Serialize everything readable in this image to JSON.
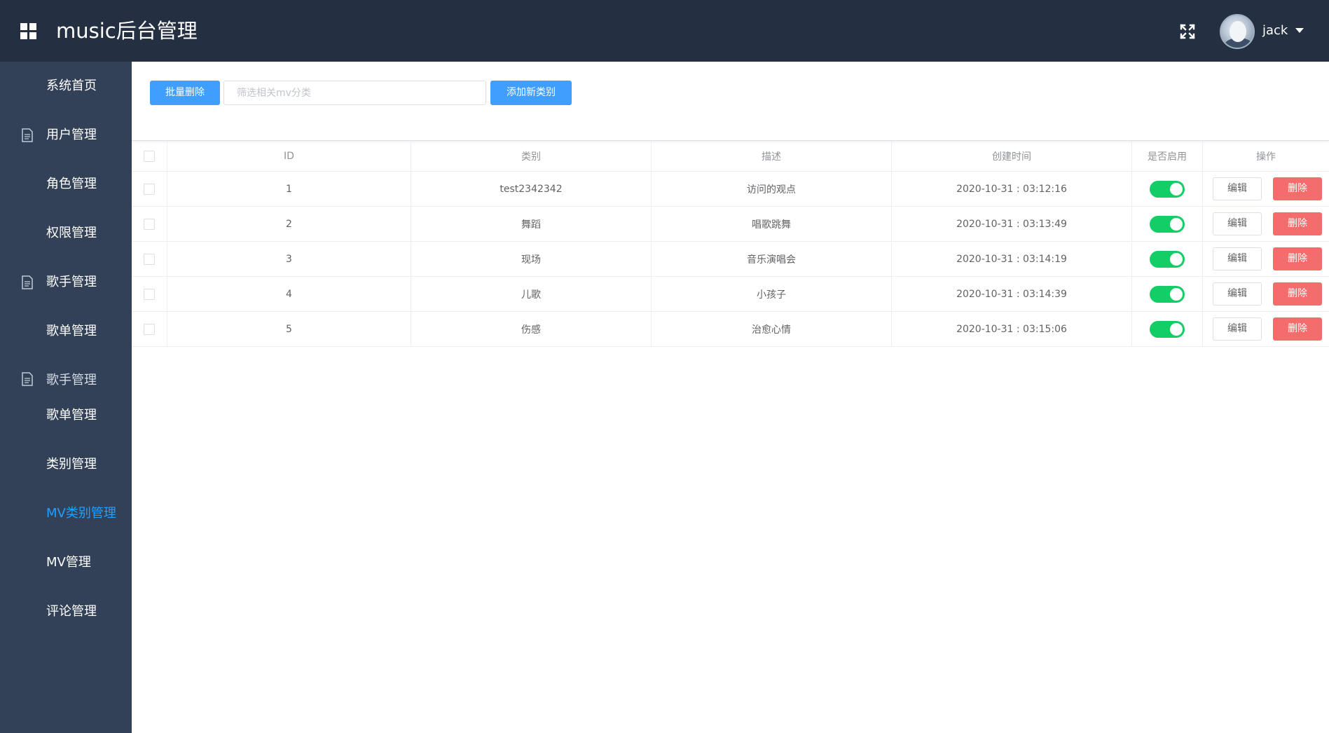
{
  "header": {
    "title": "music后台管理",
    "username": "jack"
  },
  "sidebar": {
    "items": [
      {
        "label": "系统首页",
        "icon": ""
      },
      {
        "label": "用户管理",
        "icon": "document-icon"
      },
      {
        "label": "角色管理",
        "icon": ""
      },
      {
        "label": "权限管理",
        "icon": ""
      },
      {
        "label": "歌手管理",
        "icon": "document-icon"
      },
      {
        "label": "歌单管理",
        "icon": ""
      },
      {
        "label": "歌手管理",
        "icon": "document-icon"
      },
      {
        "label": "歌单管理",
        "icon": ""
      },
      {
        "label": "类别管理",
        "icon": ""
      },
      {
        "label": "MV类别管理",
        "icon": "",
        "active": true
      },
      {
        "label": "MV管理",
        "icon": ""
      },
      {
        "label": "评论管理",
        "icon": ""
      }
    ]
  },
  "toolbar": {
    "batch_delete_label": "批量删除",
    "search_placeholder": "筛选相关mv分类",
    "search_value": "",
    "add_label": "添加新类别"
  },
  "table": {
    "headers": {
      "id": "ID",
      "category": "类别",
      "description": "描述",
      "created_at": "创建时间",
      "enabled": "是否启用",
      "actions": "操作"
    },
    "rows": [
      {
        "id": "1",
        "category": "test2342342",
        "description": "访问的观点",
        "created_at": "2020-10-31 : 03:12:16",
        "enabled": true
      },
      {
        "id": "2",
        "category": "舞蹈",
        "description": "唱歌跳舞",
        "created_at": "2020-10-31 : 03:13:49",
        "enabled": true
      },
      {
        "id": "3",
        "category": "现场",
        "description": "音乐演唱会",
        "created_at": "2020-10-31 : 03:14:19",
        "enabled": true
      },
      {
        "id": "4",
        "category": "儿歌",
        "description": "小孩子",
        "created_at": "2020-10-31 : 03:14:39",
        "enabled": true
      },
      {
        "id": "5",
        "category": "伤感",
        "description": "治愈心情",
        "created_at": "2020-10-31 : 03:15:06",
        "enabled": true
      }
    ],
    "edit_label": "编辑",
    "delete_label": "删除"
  },
  "colors": {
    "header_bg": "#242f42",
    "sidebar_bg": "#324157",
    "active_menu": "#20a0ff",
    "primary": "#409eff",
    "switch_on": "#13ce66",
    "danger": "#f56c6c"
  }
}
